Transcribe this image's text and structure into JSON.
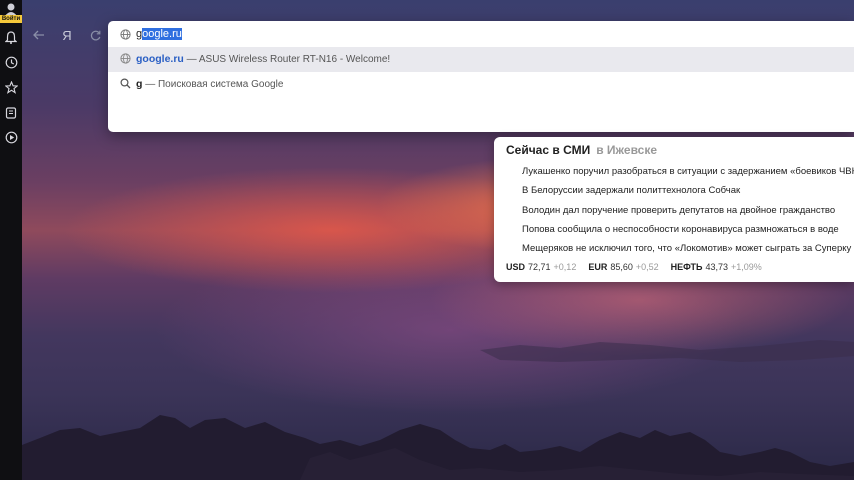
{
  "sidebar": {
    "login_label": "Войти",
    "items": [
      {
        "icon": "bell-icon"
      },
      {
        "icon": "clock-icon"
      },
      {
        "icon": "star-icon"
      },
      {
        "icon": "collections-icon"
      },
      {
        "icon": "play-icon"
      }
    ]
  },
  "toolbar": {
    "back_icon": "arrow-left-icon",
    "yandex_logo": "Я",
    "reload_icon": "reload-icon"
  },
  "omnibox": {
    "typed": "g",
    "autocompleted": "oogle.ru",
    "suggestions": [
      {
        "highlight": "google.ru",
        "rest": " — ASUS Wireless Router RT-N16 - Welcome!",
        "icon": "globe-icon"
      },
      {
        "highlight": "g",
        "rest": " — Поисковая система Google",
        "icon": "search-icon"
      }
    ]
  },
  "news": {
    "title": "Сейчас в СМИ",
    "region": "в Ижевске",
    "items": [
      "Лукашенко поручил разобраться в ситуации с задержанием «боевиков ЧВК",
      "В Белоруссии задержали политтехнолога Собчак",
      "Володин дал поручение проверить депутатов на двойное гражданство",
      "Попова сообщила о неспособности коронавируса размножаться в воде",
      "Мещеряков не исключил того, что «Локомотив» может сыграть за Суперку"
    ],
    "rates": [
      {
        "name": "USD",
        "value": "72,71",
        "change": "+0,12"
      },
      {
        "name": "EUR",
        "value": "85,60",
        "change": "+0,52"
      },
      {
        "name": "НЕФТЬ",
        "value": "43,73",
        "change": "+1,09%"
      }
    ]
  }
}
